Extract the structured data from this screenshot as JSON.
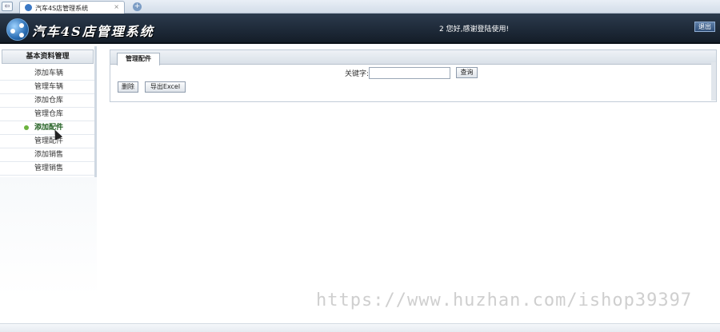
{
  "browser": {
    "nav_icon": "back-arrow-icon",
    "nav_glyph": "⇦",
    "tab_title": "汽车4S店管理系统",
    "tab_close": "×",
    "new_tab": "+"
  },
  "header": {
    "title": "汽车4S店管理系统",
    "welcome": "2 您好,感谢登陆使用!",
    "logout_label": "退出"
  },
  "sidebar": {
    "heading": "基本资料管理",
    "items": [
      {
        "label": "添加车辆"
      },
      {
        "label": "管理车辆"
      },
      {
        "label": "添加仓库"
      },
      {
        "label": "管理仓库"
      },
      {
        "label": "添加配件"
      },
      {
        "label": "管理配件"
      },
      {
        "label": "添加销售"
      },
      {
        "label": "管理销售"
      }
    ],
    "active_item": "添加配件"
  },
  "main": {
    "tab_label": "管理配件",
    "search": {
      "label": "关键字:",
      "value": "",
      "button_label": "查询"
    },
    "actions": {
      "delete_label": "删除",
      "export_label": "导出Excel"
    }
  },
  "watermark": "https://www.huzhan.com/ishop39397",
  "colors": {
    "header_bg": "#1c2735",
    "accent": "#2c6fb5",
    "active_item": "#1f5d1f"
  }
}
